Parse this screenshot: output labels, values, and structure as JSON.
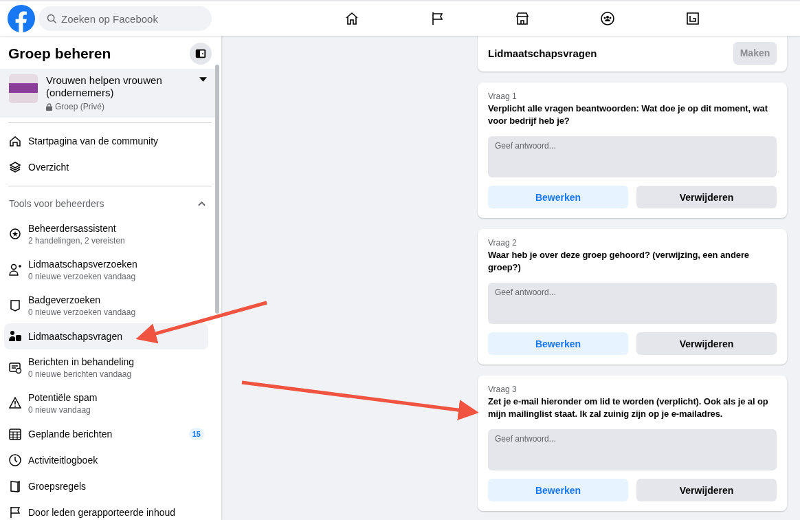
{
  "topbar": {
    "search": {
      "placeholder": "Zoeken op Facebook"
    }
  },
  "sidebar": {
    "title": "Groep beheren",
    "group": {
      "name": "Vrouwen helpen vrouwen (ondernemers)",
      "privacy": "Groep (Privé)"
    },
    "items": [
      {
        "label": "Startpagina van de community",
        "selected": false
      },
      {
        "label": "Overzicht",
        "selected": false
      }
    ],
    "section": {
      "title": "Tools voor beheerders",
      "expanded": true,
      "items": [
        {
          "label": "Beheerdersassistent",
          "subtitle": "2 handelingen, 2 vereisten",
          "selected": false
        },
        {
          "label": "Lidmaatschapsverzoeken",
          "subtitle": "0 nieuwe verzoeken vandaag",
          "selected": false
        },
        {
          "label": "Badgeverzoeken",
          "subtitle": "0 nieuwe verzoeken vandaag",
          "selected": false
        },
        {
          "label": "Lidmaatschapsvragen",
          "selected": true
        },
        {
          "label": "Berichten in behandeling",
          "subtitle": "0 nieuwe berichten vandaag",
          "selected": false
        },
        {
          "label": "Potentiële spam",
          "subtitle": "0 nieuw vandaag",
          "selected": false
        },
        {
          "label": "Geplande berichten",
          "badge": "15",
          "selected": false
        },
        {
          "label": "Activiteitlogboek",
          "selected": false
        },
        {
          "label": "Groepsregels",
          "selected": false
        },
        {
          "label": "Door leden gerapporteerde inhoud",
          "selected": false
        }
      ]
    }
  },
  "main": {
    "header": {
      "title": "Lidmaatschapsvragen",
      "button": {
        "label": "Maken",
        "disabled": true
      }
    },
    "questions": [
      {
        "label": "Vraag 1",
        "text": "Verplicht alle vragen beantwoorden: Wat doe je op dit moment, wat voor bedrijf heb je?",
        "placeholder": "Geef antwoord...",
        "buttons": [
          "Bewerken",
          "Verwijderen"
        ]
      },
      {
        "label": "Vraag 2",
        "text": "Waar heb je over deze groep gehoord? (verwijzing, een andere groep?)",
        "placeholder": "Geef antwoord...",
        "buttons": [
          "Bewerken",
          "Verwijderen"
        ]
      },
      {
        "label": "Vraag 3",
        "text": "Zet je e-mail hieronder om lid te worden (verplicht). Ook als je al op mijn mailinglist staat. Ik zal zuinig zijn op je e-mailadres.",
        "placeholder": "Geef antwoord...",
        "buttons": [
          "Bewerken",
          "Verwijderen"
        ]
      }
    ]
  }
}
